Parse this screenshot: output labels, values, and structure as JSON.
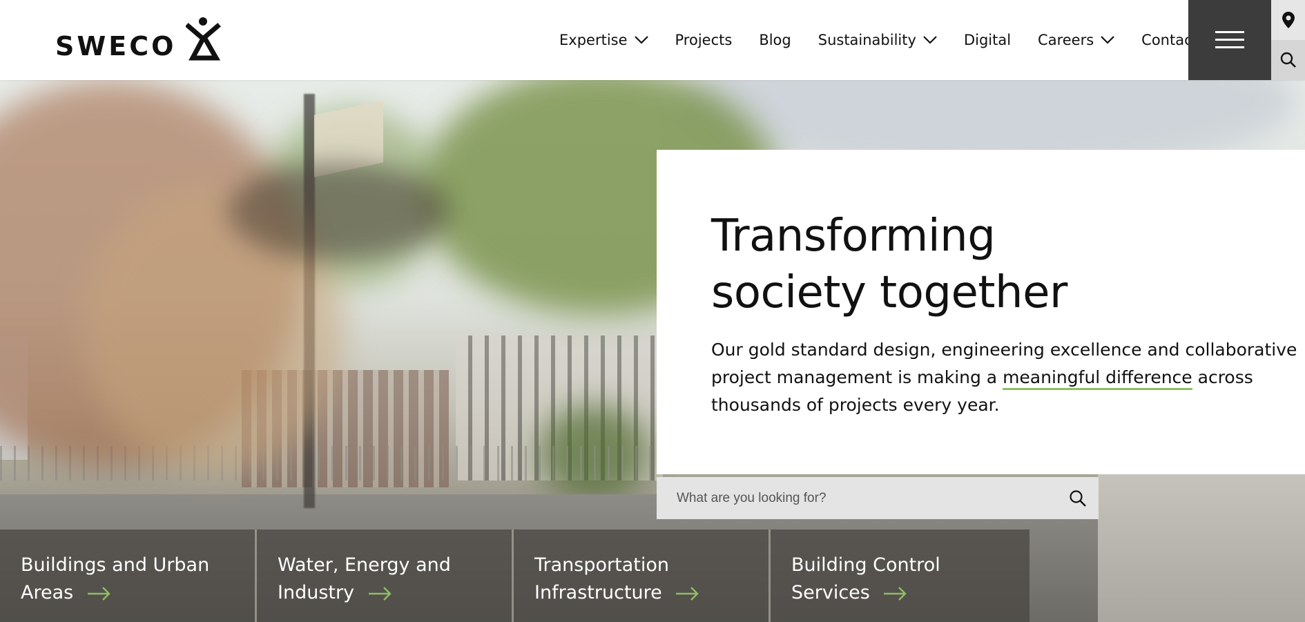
{
  "brand": {
    "name": "SWECO"
  },
  "nav": {
    "items": [
      {
        "label": "Expertise",
        "has_dropdown": true
      },
      {
        "label": "Projects",
        "has_dropdown": false
      },
      {
        "label": "Blog",
        "has_dropdown": false
      },
      {
        "label": "Sustainability",
        "has_dropdown": true
      },
      {
        "label": "Digital",
        "has_dropdown": false
      },
      {
        "label": "Careers",
        "has_dropdown": true
      },
      {
        "label": "Contact",
        "has_dropdown": false
      }
    ],
    "menu_icon": "hamburger-icon",
    "location_icon": "map-pin-icon",
    "search_icon": "search-icon"
  },
  "hero": {
    "title_line1": "Transforming",
    "title_line2": "society together",
    "body_start": "Our gold standard design, engineering excellence and collaborative project management is making a ",
    "body_link": "meaningful difference",
    "body_end": " across thousands of projects every year.",
    "link_underline_color": "#8dbf63"
  },
  "search": {
    "placeholder": "What are you looking for?",
    "icon": "search-icon"
  },
  "tiles": [
    {
      "label": "Buildings and Urban Areas"
    },
    {
      "label": "Water, Energy and Industry"
    },
    {
      "label": "Transportation Infrastructure"
    },
    {
      "label": "Building Control Services"
    }
  ],
  "colors": {
    "accent_green": "#8dbf63",
    "menu_button_bg": "#3c3c3c",
    "side_button_bg": "#e6e6e6"
  }
}
